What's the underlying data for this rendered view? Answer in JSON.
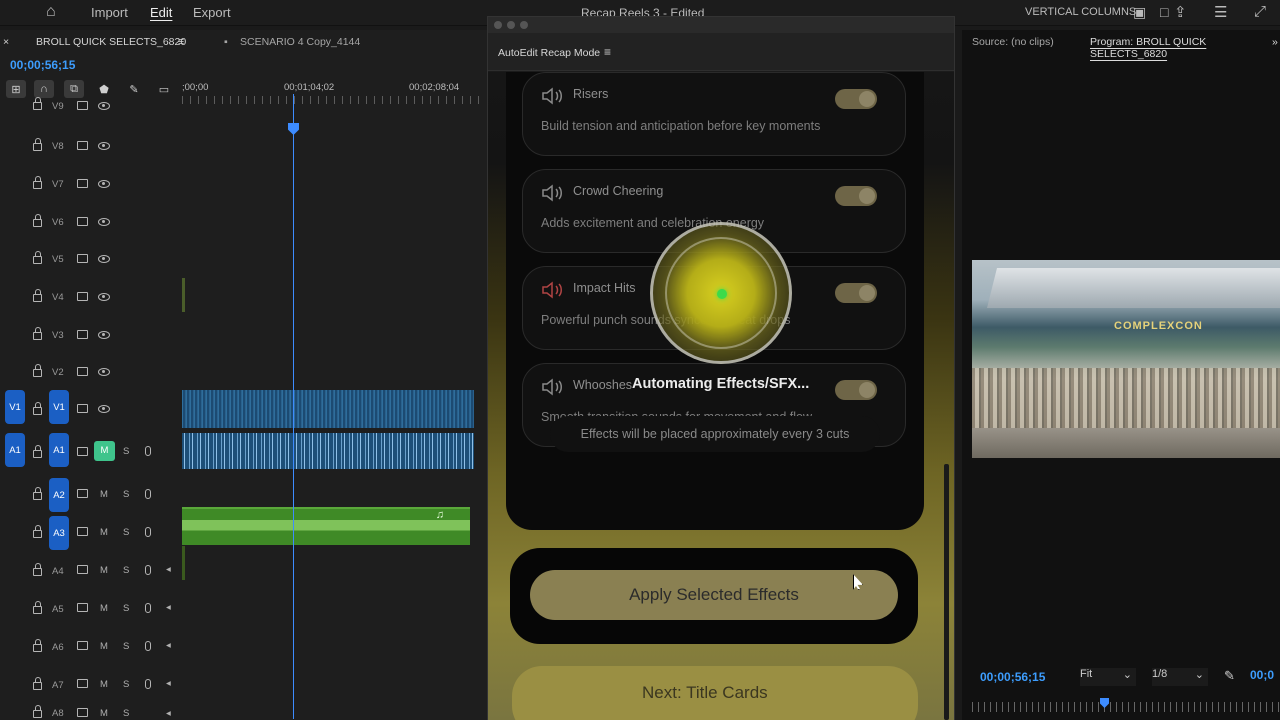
{
  "menu": {
    "import": "Import",
    "edit": "Edit",
    "export": "Export",
    "title": "Recap Reels 3 - Edited",
    "workspace": "VERTICAL COLUMNS"
  },
  "timeline": {
    "tabs": [
      "BROLL QUICK SELECTS_6820",
      "SCENARIO 4 Copy_4144"
    ],
    "timecode": "00;00;56;15",
    "ruler": [
      ";00;00",
      "00;01;04;02",
      "00;02;08;04"
    ],
    "video_tracks": [
      "V9",
      "V8",
      "V7",
      "V6",
      "V5",
      "V4",
      "V3",
      "V2",
      "V1"
    ],
    "audio_tracks": [
      "A1",
      "A2",
      "A3",
      "A4",
      "A5",
      "A6",
      "A7",
      "A8"
    ],
    "source_v": "V1",
    "source_a": "A1",
    "mute": "M",
    "solo": "S"
  },
  "plugin": {
    "title": "AutoEdit Recap Mode",
    "menu_icon": "hamburger-icon",
    "effects": [
      {
        "name": "Risers",
        "desc": "Build tension and anticipation before key moments",
        "on": true
      },
      {
        "name": "Crowd Cheering",
        "desc": "Adds excitement and celebration energy",
        "on": true
      },
      {
        "name": "Impact Hits",
        "desc": "Powerful punch sounds synced to beat drops",
        "on": true
      },
      {
        "name": "Whooshes",
        "desc": "Smooth transition sounds for movement and flow",
        "on": true
      }
    ],
    "hint": "Effects will be placed approximately every 3 cuts",
    "apply": "Apply Selected Effects",
    "next": "Next: Title Cards",
    "loading": "Automating Effects/SFX..."
  },
  "monitor": {
    "source_tab": "Source: (no clips)",
    "program_tab": "Program: BROLL QUICK SELECTS_6820",
    "timecode": "00;00;56;15",
    "fit": "Fit",
    "resolution": "1/8",
    "timecode_right": "00;0",
    "sign": "COMPLEXCON"
  }
}
